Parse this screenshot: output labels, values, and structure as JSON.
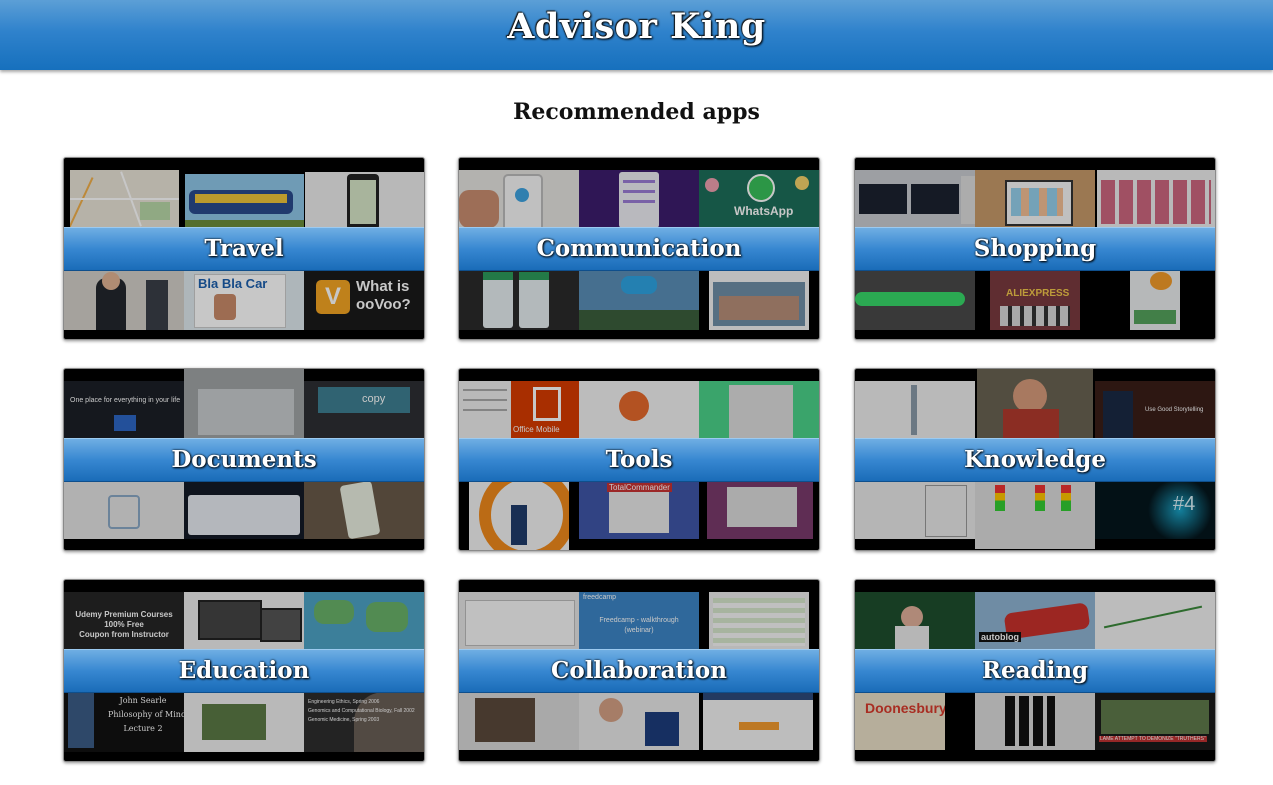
{
  "header": {
    "title": "Advisor King"
  },
  "section": {
    "title": "Recommended apps"
  },
  "categories": [
    {
      "label": "Travel",
      "thumb_texts": {
        "bottom_right": "What is\nooVoo?",
        "logo": "V",
        "bottom_mid": "Bla Bla Car"
      }
    },
    {
      "label": "Communication",
      "thumb_texts": {
        "top_right": "WhatsApp"
      }
    },
    {
      "label": "Shopping",
      "thumb_texts": {
        "bottom_mid": "ALIEXPRESS"
      }
    },
    {
      "label": "Documents",
      "thumb_texts": {
        "top_left": "One place for everything in your life",
        "top_right": "copy"
      }
    },
    {
      "label": "Tools",
      "thumb_texts": {
        "top_mid": "Office Mobile",
        "bottom_mid": "TotalCommander"
      }
    },
    {
      "label": "Knowledge",
      "thumb_texts": {
        "top_right": "Use Good Storytelling",
        "bottom_right": "#4"
      }
    },
    {
      "label": "Education",
      "thumb_texts": {
        "top_left": "Udemy Premium Courses\n100% Free\nCoupon from Instructor",
        "bottom_left": "John Searle\nPhilosophy of Mind\nLecture 2",
        "bottom_right": "Engineering Ethics, Spring 2006\nGenomics and Computational Biology, Fall 2002\nGenomic Medicine, Spring 2003"
      }
    },
    {
      "label": "Collaboration",
      "thumb_texts": {
        "top_mid": "Freedcamp - walkthrough\n(webinar)",
        "top_mid_logo": "freedcamp"
      }
    },
    {
      "label": "Reading",
      "thumb_texts": {
        "top_mid": "autoblog",
        "bottom_left": "Doonesbury",
        "bottom_right": "LAME ATTEMPT TO DEMONIZE \"TRUTHERS\""
      }
    }
  ],
  "colors": {
    "header_blue": "#1670bd",
    "band_blue": "#3787d1"
  }
}
